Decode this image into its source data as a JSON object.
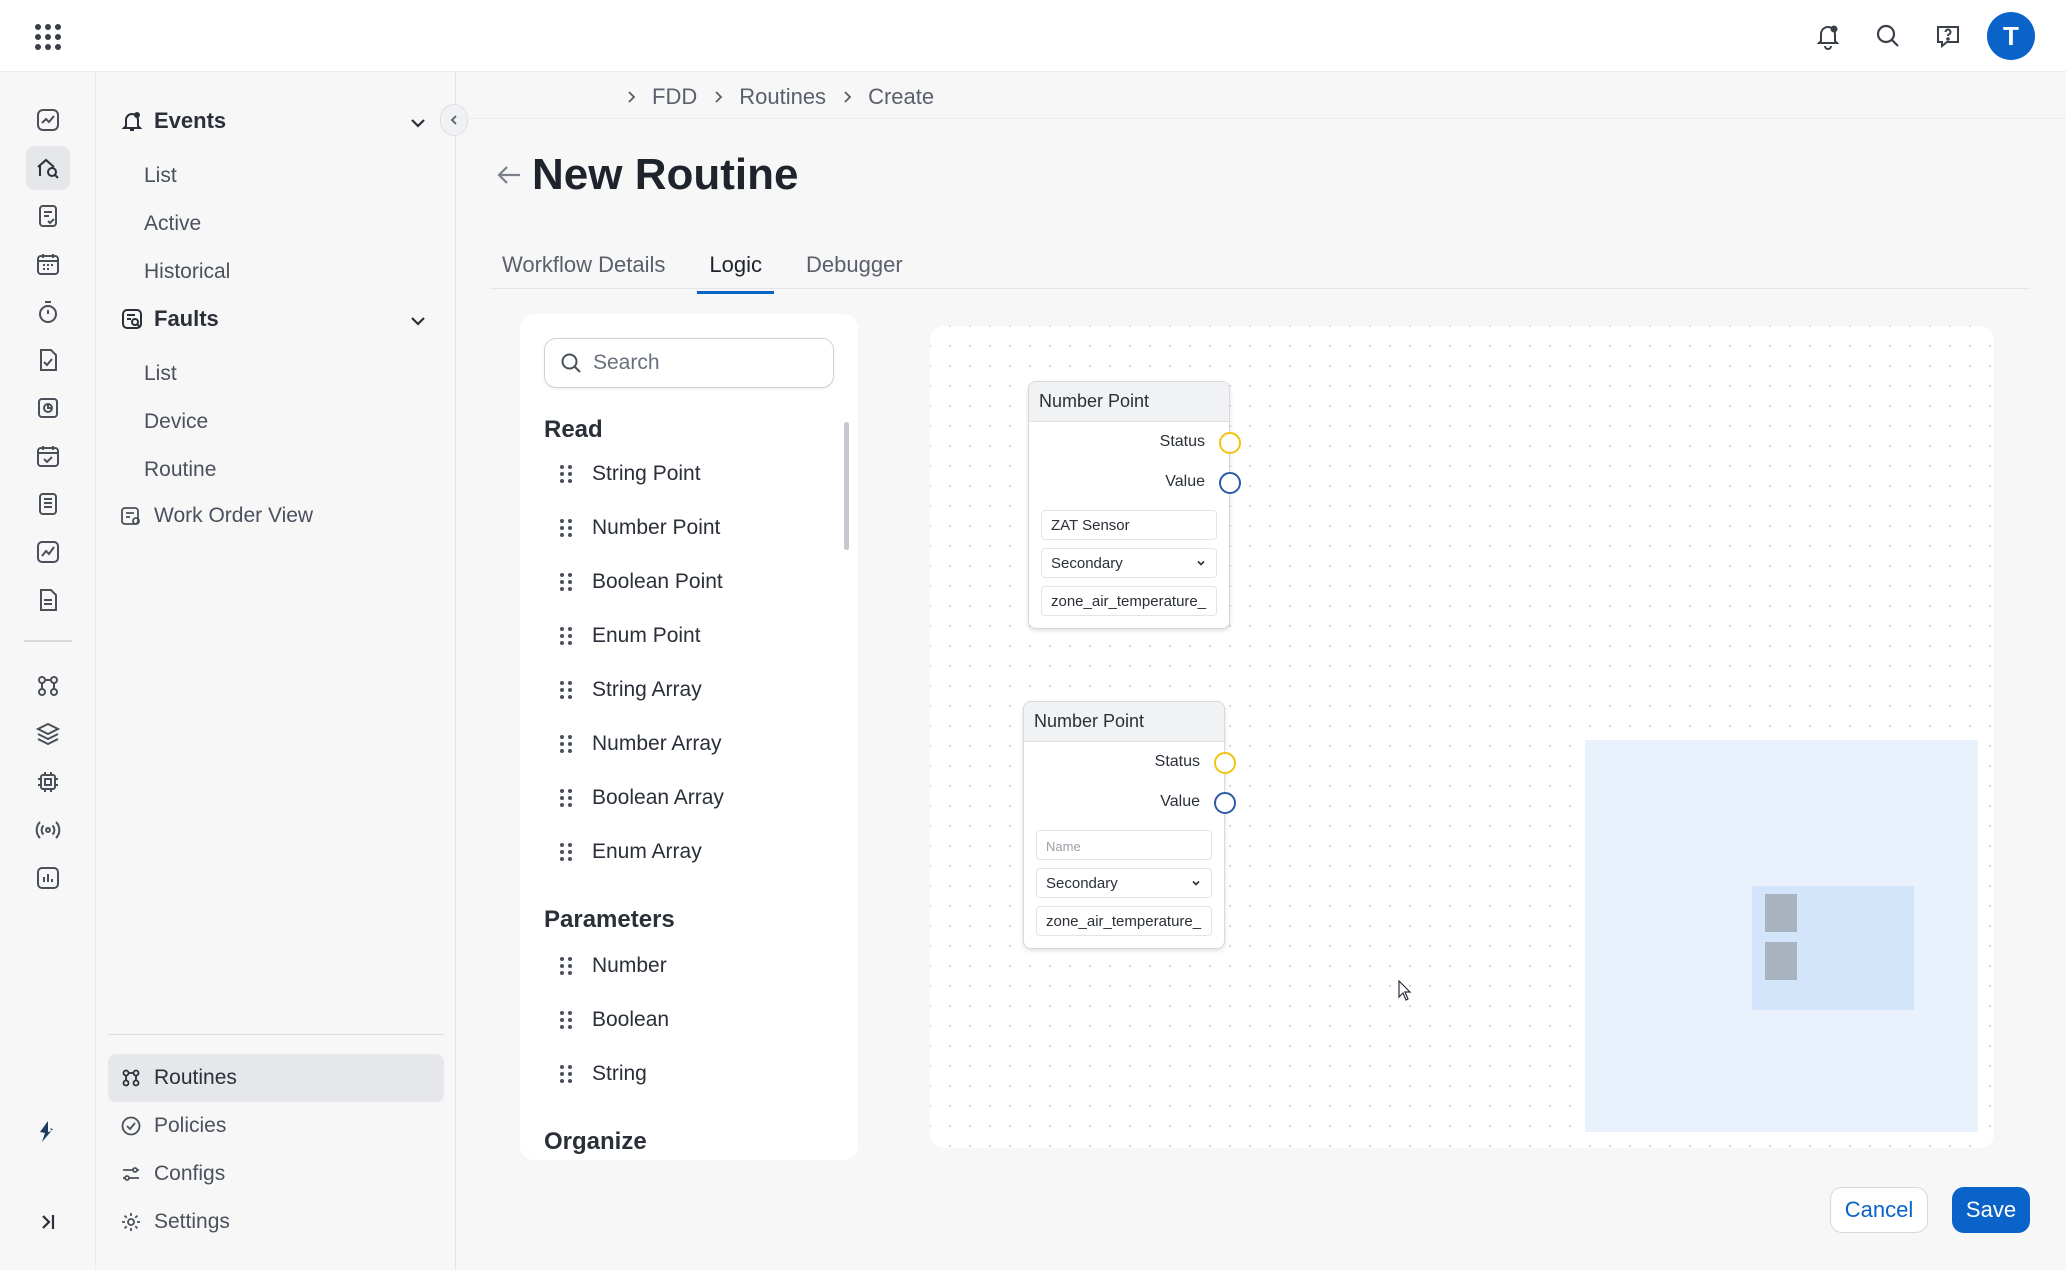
{
  "topbar": {
    "apps_icon": "apps-grid-icon",
    "icons": [
      "bell-icon",
      "search-icon",
      "help-chat-icon"
    ],
    "avatar_initial": "T",
    "accent": "#0a63c9"
  },
  "rail": {
    "items": [
      "dashboard-icon",
      "analytics-home-icon",
      "checklist-icon",
      "calendar-icon",
      "timer-icon",
      "document-check-icon",
      "report-icon",
      "schedule-icon",
      "list-document-icon",
      "chart-icon",
      "file-icon",
      "routines-icon",
      "layers-icon",
      "chip-icon",
      "broadcast-icon",
      "bar-chart-icon"
    ],
    "selected": "analytics-home-icon"
  },
  "nav": {
    "events": {
      "label": "Events",
      "items": [
        "List",
        "Active",
        "Historical"
      ]
    },
    "faults": {
      "label": "Faults",
      "items": [
        "List",
        "Device",
        "Routine"
      ]
    },
    "work_order_view": "Work Order View",
    "bottom": [
      {
        "label": "Routines",
        "icon": "routines-icon",
        "selected": true
      },
      {
        "label": "Policies",
        "icon": "shield-check-icon",
        "selected": false
      },
      {
        "label": "Configs",
        "icon": "sliders-icon",
        "selected": false
      },
      {
        "label": "Settings",
        "icon": "gear-icon",
        "selected": false
      }
    ]
  },
  "breadcrumb": [
    "FDD",
    "Routines",
    "Create"
  ],
  "page_title": "New Routine",
  "tabs": [
    {
      "label": "Workflow Details",
      "active": false
    },
    {
      "label": "Logic",
      "active": true
    },
    {
      "label": "Debugger",
      "active": false
    }
  ],
  "palette": {
    "search_placeholder": "Search",
    "sections": {
      "read": {
        "label": "Read",
        "items": [
          "String Point",
          "Number Point",
          "Boolean Point",
          "Enum Point",
          "String Array",
          "Number Array",
          "Boolean Array",
          "Enum Array"
        ]
      },
      "parameters": {
        "label": "Parameters",
        "items": [
          "Number",
          "Boolean",
          "String"
        ]
      },
      "organize": {
        "label": "Organize"
      }
    }
  },
  "canvas": {
    "nodes": [
      {
        "title": "Number Point",
        "status_label": "Status",
        "value_label": "Value",
        "name_value": "ZAT Sensor",
        "name_placeholder": "",
        "select_value": "Secondary",
        "point_value": "zone_air_temperature_"
      },
      {
        "title": "Number Point",
        "status_label": "Status",
        "value_label": "Value",
        "name_value": "",
        "name_placeholder": "Name",
        "select_value": "Secondary",
        "point_value": "zone_air_temperature_"
      }
    ]
  },
  "actions": {
    "cancel": "Cancel",
    "save": "Save"
  }
}
